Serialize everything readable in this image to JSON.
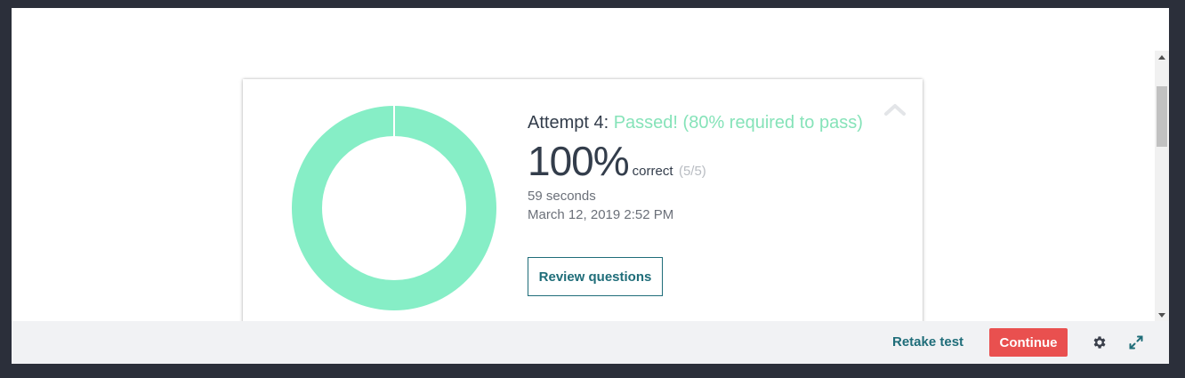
{
  "result": {
    "attempt_label": "Attempt 4:",
    "status_text": "Passed! (80% required to pass)",
    "score_percent": "100%",
    "score_correct_label": "correct",
    "score_fraction": "(5/5)",
    "duration": "59 seconds",
    "datetime": "March 12, 2019 2:52 PM",
    "review_button_label": "Review questions",
    "score_value": 1.0
  },
  "footer": {
    "retake_label": "Retake test",
    "continue_label": "Continue"
  },
  "icons": {
    "collapse": "chevron-up-icon",
    "settings": "gear-icon",
    "fullscreen": "expand-icon"
  },
  "colors": {
    "donut": "#86eec6",
    "passed_text": "#86e3b9",
    "accent": "#1f6d79",
    "continue_button": "#e9504f"
  }
}
